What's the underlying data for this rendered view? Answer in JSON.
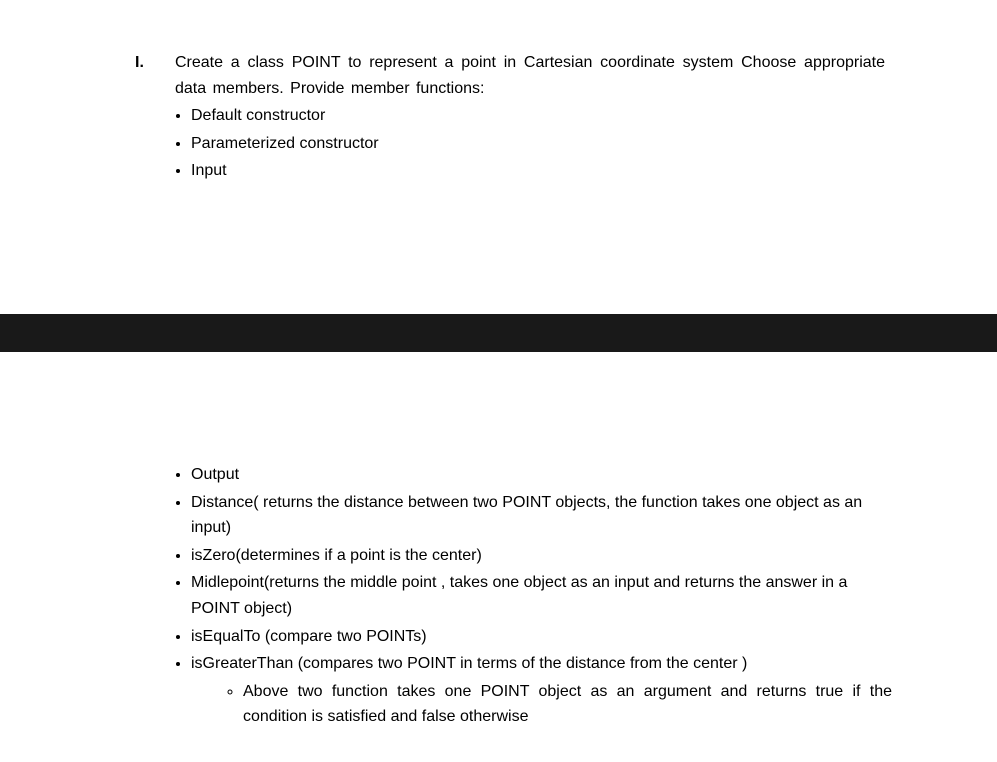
{
  "question": {
    "numeral": "I.",
    "intro": "Create a class POINT to represent a point in Cartesian coordinate system Choose appropriate data members. Provide member functions:",
    "top_items": [
      "Default constructor",
      "Parameterized constructor",
      "Input"
    ],
    "bottom_items": [
      "Output",
      "Distance( returns the distance between two POINT objects, the function takes one object as an input)",
      "isZero(determines  if a point is the center)",
      "Midlepoint(returns the middle point , takes one object as an input and returns the answer in a POINT object)",
      "isEqualTo (compare two POINTs)",
      "isGreaterThan (compares two POINT in terms of the distance from the center )"
    ],
    "sub_item": "Above  two function takes one POINT  object as an argument and returns true if the condition is satisfied and false otherwise"
  }
}
